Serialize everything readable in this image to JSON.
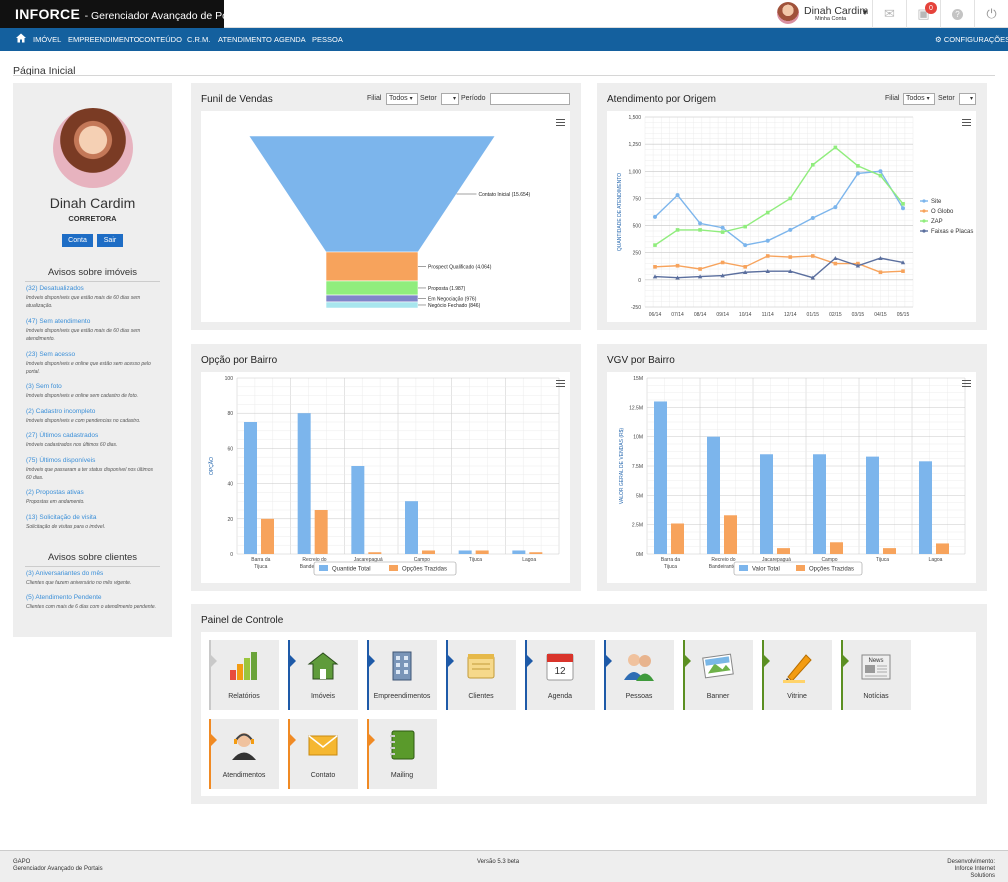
{
  "app": {
    "brand": "INFORCE",
    "subtitle": "- Gerenciador Avançado de Portais"
  },
  "user": {
    "name": "Dinah Cardim",
    "sub": "Minha Conta",
    "notif_count": "0"
  },
  "topbar_icons": [
    "mail-icon",
    "monitor-icon",
    "help-icon",
    "power-icon"
  ],
  "nav": {
    "items": [
      "IMÓVEL",
      "EMPREENDIMENTO",
      "CONTEÚDO",
      "C.R.M.",
      "ATENDIMENTO",
      "AGENDA",
      "PESSOA"
    ],
    "config": "CONFIGURAÇÕES"
  },
  "page": {
    "title": "Página Inicial"
  },
  "profile": {
    "name": "Dinah Cardim",
    "role": "CORRETORA",
    "btn_account": "Conta",
    "btn_exit": "Sair"
  },
  "avisos_imoveis": {
    "title": "Avisos sobre imóveis",
    "items": [
      {
        "link": "(32) Desatualizados",
        "desc": "Imóveis disponíveis que estão mais de 60 dias sem atualização."
      },
      {
        "link": "(47) Sem atendimento",
        "desc": "Imóveis disponíveis que estão mais de 60 dias sem atendimento."
      },
      {
        "link": "(23) Sem acesso",
        "desc": "Imóveis disponíveis e online que estão sem acesso pelo portal."
      },
      {
        "link": "(3) Sem foto",
        "desc": "Imóveis disponíveis e online sem cadastro de foto."
      },
      {
        "link": "(2) Cadastro incompleto",
        "desc": "Imóveis disponíveis e com pendencias no cadastro."
      },
      {
        "link": "(27) Últimos cadastrados",
        "desc": "Imóveis cadastrados nos últimos 60 dias."
      },
      {
        "link": "(75) Últimos disponíveis",
        "desc": "Imóveis que passaram a ter status disponível nos últimos 60 dias."
      },
      {
        "link": "(2) Propostas ativas",
        "desc": "Propostas em andamento."
      },
      {
        "link": "(13) Solicitação de visita",
        "desc": "Solicitação de visitas para o imóvel."
      }
    ]
  },
  "avisos_clientes": {
    "title": "Avisos sobre clientes",
    "items": [
      {
        "link": "(3) Aniversariantes do mês",
        "desc": "Clientes que fazem aniversário no mês vigente."
      },
      {
        "link": "(5) Atendimento Pendente",
        "desc": "Clientes com mais de 6 dias com o atendimento pendente."
      }
    ]
  },
  "funil": {
    "title": "Funil de Vendas",
    "filter": {
      "filial_label": "Filial",
      "filial_value": "Todos",
      "setor_label": "Setor",
      "periodo_label": "Período"
    }
  },
  "atendimento": {
    "title": "Atendimento por Origem",
    "filter": {
      "filial_label": "Filial",
      "filial_value": "Todos",
      "setor_label": "Setor"
    }
  },
  "opcao": {
    "title": "Opção por Bairro"
  },
  "vgv": {
    "title": "VGV por Bairro"
  },
  "chart_data": [
    {
      "type": "funnel",
      "stages": [
        {
          "label": "Contato Inicial",
          "value": 15654,
          "display": "Contato Inicial (15.654)",
          "color": "#7cb5ec"
        },
        {
          "label": "Prospect Qualificado",
          "value": 4064,
          "display": "Prospect Qualificado (4.064)",
          "color": "#f7a35c"
        },
        {
          "label": "Proposta",
          "value": 1987,
          "display": "Proposta (1.987)",
          "color": "#90ed7d"
        },
        {
          "label": "Em Negociação",
          "value": 976,
          "display": "Em Negociação (976)",
          "color": "#8085c9"
        },
        {
          "label": "Negócio Fechado",
          "value": 846,
          "display": "Negócio Fechado (846)",
          "color": "#a8e6ee"
        }
      ]
    },
    {
      "type": "line",
      "ylabel": "QUANTIDADE DE ATENDIMENTO",
      "ylim": [
        -250,
        1500
      ],
      "yticks": [
        -250,
        0,
        250,
        500,
        750,
        "1,000",
        "1,250",
        "1,500"
      ],
      "x": [
        "06/14",
        "07/14",
        "08/14",
        "09/14",
        "10/14",
        "11/14",
        "12/14",
        "01/15",
        "02/15",
        "03/15",
        "04/15",
        "05/15"
      ],
      "series": [
        {
          "name": "Site",
          "color": "#7cb5ec",
          "values": [
            580,
            780,
            520,
            480,
            320,
            360,
            460,
            570,
            670,
            980,
            1000,
            660
          ]
        },
        {
          "name": "O Globo",
          "color": "#f7a35c",
          "values": [
            120,
            130,
            100,
            160,
            120,
            220,
            210,
            220,
            150,
            150,
            70,
            80
          ]
        },
        {
          "name": "ZAP",
          "color": "#90ed7d",
          "values": [
            320,
            460,
            460,
            440,
            490,
            620,
            750,
            1060,
            1220,
            1050,
            960,
            700
          ]
        },
        {
          "name": "Faixas e Placas",
          "color": "#5b6f9e",
          "values": [
            30,
            20,
            30,
            40,
            70,
            80,
            80,
            20,
            200,
            130,
            200,
            160
          ]
        }
      ]
    },
    {
      "type": "bar",
      "ylabel": "OPÇÃO",
      "ylim": [
        0,
        100
      ],
      "yticks": [
        0,
        20,
        40,
        60,
        80,
        100
      ],
      "categories": [
        [
          "Barra da",
          "Tijuca"
        ],
        [
          "Recreio do",
          "Bandeirantes"
        ],
        [
          "Jacarepaguá"
        ],
        [
          "Campo",
          "Grande"
        ],
        [
          "Tijuca"
        ],
        [
          "Lagoa"
        ]
      ],
      "series": [
        {
          "name": "Quantide Total",
          "color": "#7cb5ec",
          "values": [
            75,
            80,
            50,
            30,
            2,
            2
          ]
        },
        {
          "name": "Opções Trazidas",
          "color": "#f7a35c",
          "values": [
            20,
            25,
            1,
            2,
            2,
            1
          ]
        }
      ]
    },
    {
      "type": "bar",
      "ylabel": "VALOR GERAL DE VENDAS (R$)",
      "ylim": [
        0,
        15
      ],
      "yticks": [
        "0M",
        "2.5M",
        "5M",
        "7.5M",
        "10M",
        "12.5M",
        "15M"
      ],
      "categories": [
        [
          "Barra da",
          "Tijuca"
        ],
        [
          "Recreio do",
          "Bandeirantes"
        ],
        [
          "Jacarepaguá"
        ],
        [
          "Campo",
          "Grande"
        ],
        [
          "Tijuca"
        ],
        [
          "Lagoa"
        ]
      ],
      "series": [
        {
          "name": "Valor Total",
          "color": "#7cb5ec",
          "values": [
            13,
            10,
            8.5,
            8.5,
            8.3,
            7.9
          ]
        },
        {
          "name": "Opções Trazidas",
          "color": "#f7a35c",
          "values": [
            2.6,
            3.3,
            0.5,
            1.0,
            0.5,
            0.9
          ]
        }
      ]
    }
  ],
  "painel": {
    "title": "Painel de Controle",
    "tiles": [
      {
        "label": "Relatórios",
        "accent": "#c9c9c9",
        "icon": "reports-icon"
      },
      {
        "label": "Imóveis",
        "accent": "#1e5aa8",
        "icon": "house-icon"
      },
      {
        "label": "Empreendimentos",
        "accent": "#1e5aa8",
        "icon": "building-icon"
      },
      {
        "label": "Clientes",
        "accent": "#1e5aa8",
        "icon": "clients-icon"
      },
      {
        "label": "Agenda",
        "accent": "#1e5aa8",
        "icon": "calendar-icon"
      },
      {
        "label": "Pessoas",
        "accent": "#1e5aa8",
        "icon": "people-icon"
      },
      {
        "label": "Banner",
        "accent": "#5b8f22",
        "icon": "banner-icon"
      },
      {
        "label": "Vitrine",
        "accent": "#5b8f22",
        "icon": "marker-icon"
      },
      {
        "label": "Notícias",
        "accent": "#5b8f22",
        "icon": "news-icon"
      },
      {
        "label": "Atendimentos",
        "accent": "#f08a24",
        "icon": "support-icon"
      },
      {
        "label": "Contato",
        "accent": "#f08a24",
        "icon": "envelope-icon"
      },
      {
        "label": "Mailing",
        "accent": "#f08a24",
        "icon": "notebook-icon"
      }
    ]
  },
  "footer": {
    "left_1": "GAPO",
    "left_2": "Gerenciador Avançado de Portais",
    "center": "Versão 5.3 beta",
    "right_1": "Desenvolvimento:",
    "right_2": "Inforce Internet Solutions"
  }
}
